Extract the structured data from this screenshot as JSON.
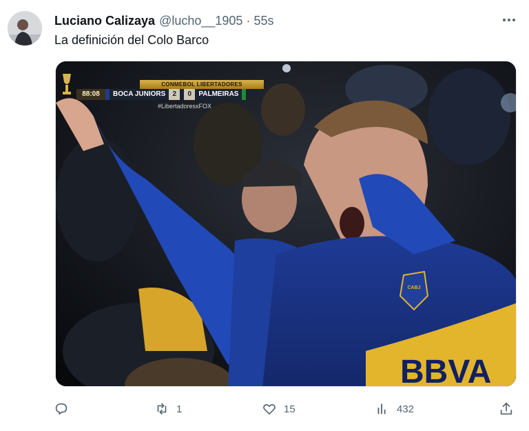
{
  "author": {
    "display_name": "Luciano Calizaya",
    "handle": "@lucho__1905",
    "separator": "·",
    "timestamp": "55s"
  },
  "tweet": {
    "text": "La definición del Colo Barco",
    "more_icon": "more-horizontal-icon"
  },
  "media": {
    "scorebug": {
      "competition": "CONMEBOL LIBERTADORES",
      "clock": "88:08",
      "home_team": "BOCA JUNIORS",
      "home_score": "2",
      "away_score": "0",
      "away_team": "PALMEIRAS",
      "hashtag": "#LibertadoresxFOX"
    },
    "jersey_text": "BBVA",
    "crest_text": "CABJ"
  },
  "actions": {
    "reply": {
      "icon": "reply-icon",
      "count": ""
    },
    "retweet": {
      "icon": "retweet-icon",
      "count": "1"
    },
    "like": {
      "icon": "heart-icon",
      "count": "15"
    },
    "views": {
      "icon": "views-chart-icon",
      "count": "432"
    },
    "share": {
      "icon": "share-icon",
      "count": ""
    }
  },
  "colors": {
    "text_primary": "#0f1419",
    "text_secondary": "#536471",
    "boca_blue": "#1f3f9e",
    "boca_gold": "#e3b52c"
  }
}
